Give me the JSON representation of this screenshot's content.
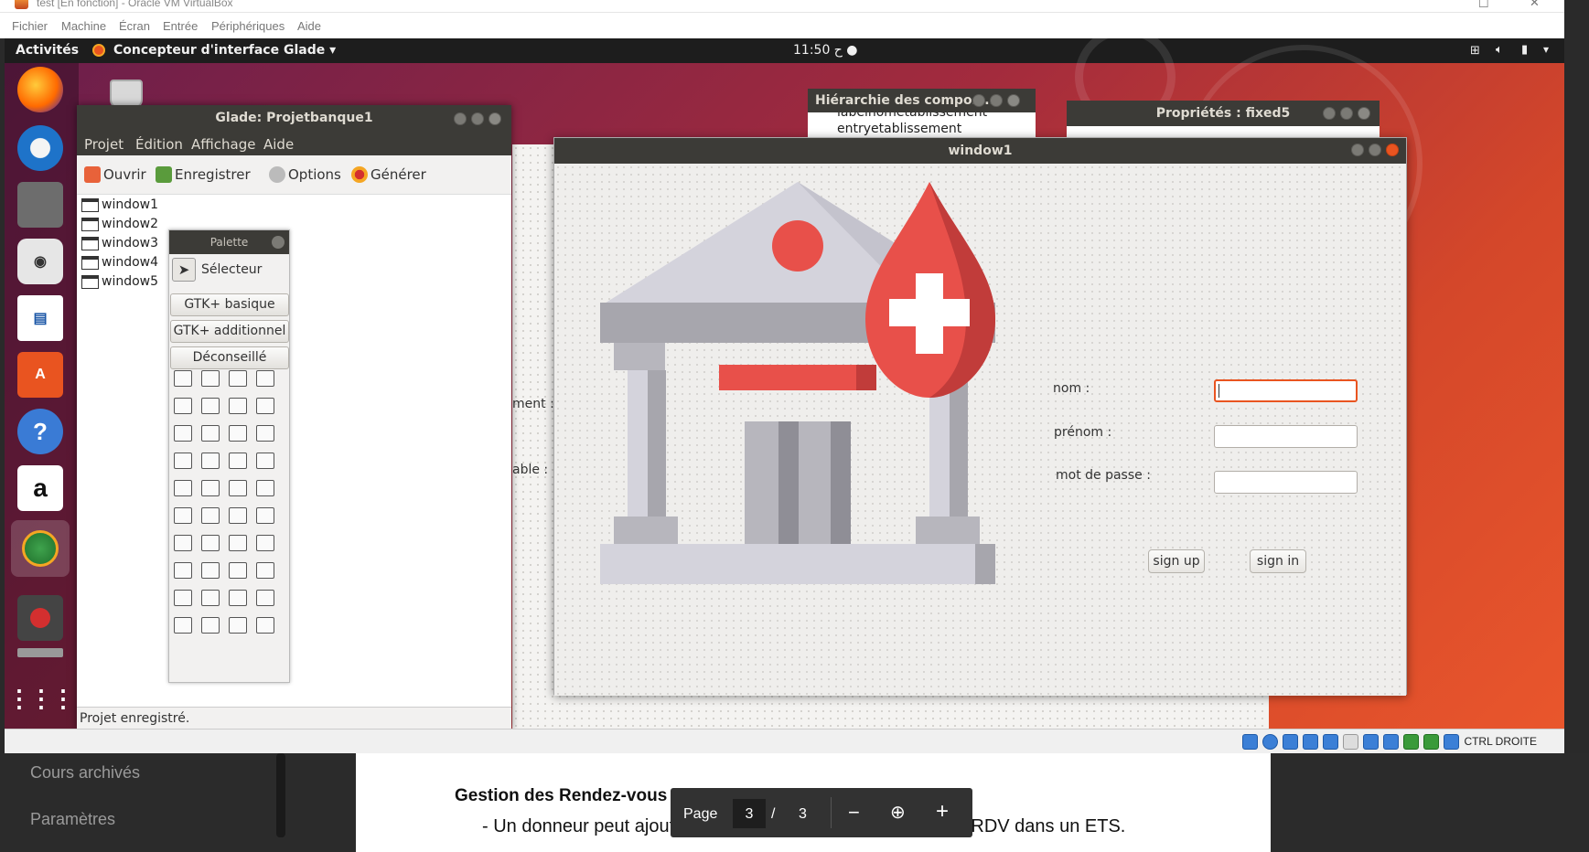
{
  "vbox": {
    "title": "test [En fonction] - Oracle VM VirtualBox",
    "menu": [
      "Fichier",
      "Machine",
      "Écran",
      "Entrée",
      "Périphériques",
      "Aide"
    ],
    "host_key": "CTRL DROITE"
  },
  "ubuntu": {
    "activities": "Activités",
    "app_menu": "Concepteur d'interface Glade ▾",
    "clock": "11:50 ح ●"
  },
  "glade": {
    "title": "Glade: Projetbanque1",
    "menu": [
      "Projet",
      "Édition",
      "Affichage",
      "Aide"
    ],
    "toolbar": {
      "open": "Ouvrir",
      "save": "Enregistrer",
      "options": "Options",
      "generate": "Générer"
    },
    "tree": [
      "window1",
      "window2",
      "window3",
      "window4",
      "window5"
    ],
    "status": "Projet enregistré."
  },
  "palette": {
    "title": "Palette",
    "selector": "Sélecteur",
    "groups": [
      "GTK+ basique",
      "GTK+ additionnel",
      "Déconseillé"
    ]
  },
  "hierarchy": {
    "title": "Hiérarchie des compos...",
    "item_partial": "labelnometablissement",
    "item": "entryetablissement"
  },
  "properties": {
    "title": "Propriétés : fixed5"
  },
  "background_labels": {
    "left1": "ment :",
    "left2": "able :"
  },
  "window1": {
    "title": "window1",
    "labels": {
      "nom": "nom :",
      "prenom": "prénom :",
      "password": "mot de passe :"
    },
    "buttons": {
      "signup": "sign up",
      "signin": "sign in"
    }
  },
  "browser": {
    "sidebar": [
      "Cours archivés",
      "Paramètres"
    ],
    "doc_heading": "Gestion des Rendez-vous donneurs",
    "doc_text": "- Un donneur peut ajouter, modifier, supprimer et afficher un RDV dans un ETS.",
    "pager": {
      "label": "Page",
      "current": "3",
      "sep": "/",
      "total": "3"
    }
  },
  "colors": {
    "accent": "#e95420",
    "titlebar": "#3c3b37",
    "blood": "#e8504a"
  }
}
